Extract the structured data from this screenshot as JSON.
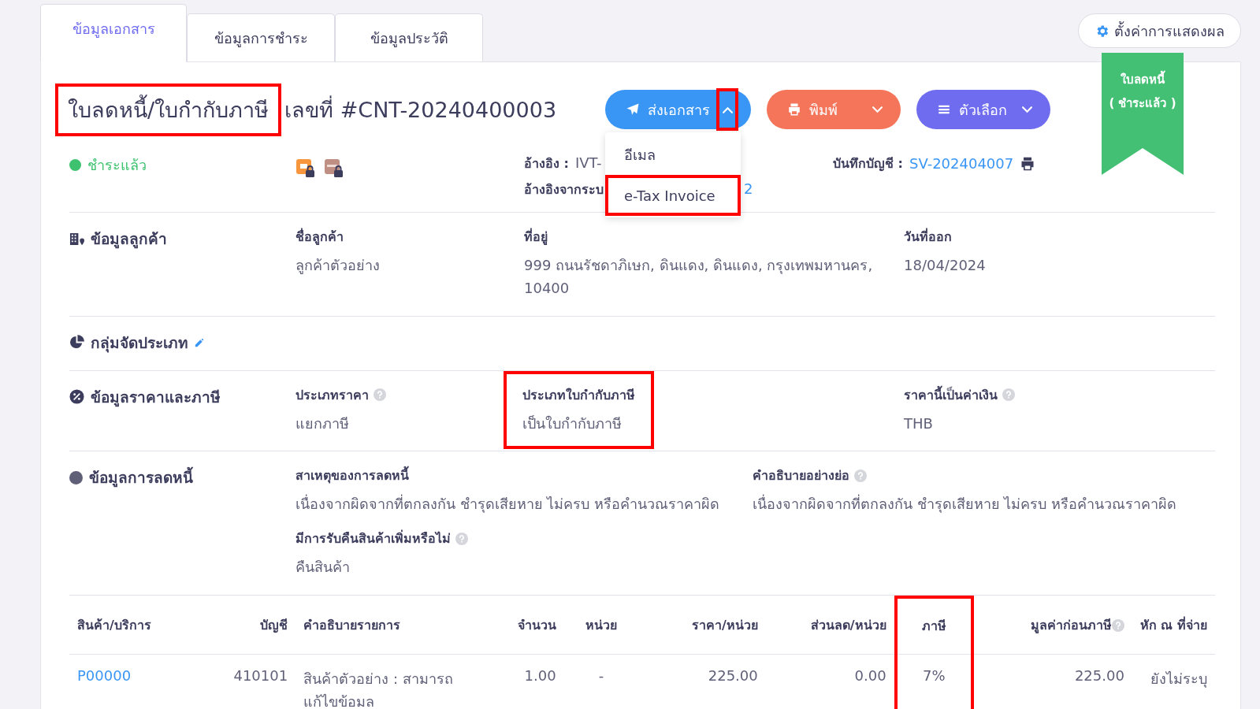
{
  "tabs": [
    {
      "label": "ข้อมูลเอกสาร",
      "selected": true
    },
    {
      "label": "ข้อมูลการชำระ",
      "selected": false
    },
    {
      "label": "ข้อมูลประวัติ",
      "selected": false
    }
  ],
  "settings_button": {
    "label": "ตั้งค่าการแสดงผล"
  },
  "ribbon": {
    "title": "ใบลดหนี้",
    "status": "( ชำระแล้ว )"
  },
  "document": {
    "doc_type": "ใบลดหนี้/ใบกำกับภาษี",
    "doc_type_highlighted": true,
    "number": "เลขที่ #CNT-20240400003"
  },
  "actions": [
    {
      "kind": "send",
      "label": "ส่งเอกสาร",
      "open": true,
      "highlighted": true
    },
    {
      "kind": "print",
      "label": "พิมพ์",
      "open": false,
      "highlighted": false
    },
    {
      "kind": "options",
      "label": "ตัวเลือก",
      "open": false,
      "highlighted": false
    }
  ],
  "send_menu": [
    {
      "label": "อีเมล",
      "highlighted": false
    },
    {
      "label": "e-Tax Invoice",
      "highlighted": true
    }
  ],
  "status": {
    "label": "ชำระแล้ว",
    "color": "#3ec26f"
  },
  "references": [
    {
      "label": "อ้างอิง :",
      "value": "IVT-"
    },
    {
      "label": "อ้างอิงจากระบ",
      "value": "2"
    }
  ],
  "accounting": {
    "label": "บันทึกบัญชี :",
    "value": "SV-202404007"
  },
  "customer": {
    "title": "ข้อมูลลูกค้า",
    "fields": [
      {
        "label": "ชื่อลูกค้า",
        "value": "ลูกค้าตัวอย่าง"
      },
      {
        "label": "ที่อยู่",
        "value": "999 ถนนรัชดาภิเษก, ดินแดง, ดินแดง, กรุงเทพมหานคร, 10400"
      },
      {
        "label": "วันที่ออก",
        "value": "18/04/2024"
      }
    ]
  },
  "category": {
    "title": "กลุ่มจัดประเภท"
  },
  "pricing": {
    "title": "ข้อมูลราคาและภาษี",
    "fields": [
      {
        "label": "ประเภทราคา",
        "value": "แยกภาษี",
        "help": true,
        "highlighted": false
      },
      {
        "label": "ประเภทใบกำกับภาษี",
        "value": "เป็นใบกำกับภาษี",
        "help": false,
        "highlighted": true
      },
      {
        "label": "ราคานี้เป็นค่าเงิน",
        "value": "THB",
        "help": true,
        "highlighted": false
      }
    ]
  },
  "debit": {
    "title": "ข้อมูลการลดหนี้",
    "fields": [
      {
        "label": "สาเหตุของการลดหนี้",
        "value": "เนื่องจากผิดจากที่ตกลงกัน ชำรุดเสียหาย ไม่ครบ หรือคำนวณราคาผิด",
        "help": false
      },
      {
        "label": "คำอธิบายอย่างย่อ",
        "value": "เนื่องจากผิดจากที่ตกลงกัน ชำรุดเสียหาย ไม่ครบ หรือคำนวณราคาผิด",
        "help": true
      },
      {
        "label": "มีการรับคืนสินค้าเพิ่มหรือไม่",
        "value": "คืนสินค้า",
        "help": true
      }
    ]
  },
  "table": {
    "columns": [
      {
        "label": "สินค้า/บริการ",
        "help": false,
        "highlighted": false
      },
      {
        "label": "บัญชี",
        "help": false,
        "highlighted": false
      },
      {
        "label": "คำอธิบายรายการ",
        "help": false,
        "highlighted": false
      },
      {
        "label": "จำนวน",
        "help": false,
        "highlighted": false
      },
      {
        "label": "หน่วย",
        "help": false,
        "highlighted": false
      },
      {
        "label": "ราคา/หน่วย",
        "help": false,
        "highlighted": false
      },
      {
        "label": "ส่วนลด/หน่วย",
        "help": false,
        "highlighted": false
      },
      {
        "label": "ภาษี",
        "help": false,
        "highlighted": true
      },
      {
        "label": "มูลค่าก่อนภาษี",
        "help": true,
        "highlighted": false
      },
      {
        "label": "หัก ณ ที่จ่าย",
        "help": false,
        "highlighted": false
      }
    ],
    "rows": [
      [
        "P00000",
        "410101",
        "สินค้าตัวอย่าง : สามารถแก้ไขข้อมล",
        "1.00",
        "-",
        "225.00",
        "0.00",
        "7%",
        "225.00",
        "ยังไม่ระบุ"
      ]
    ]
  }
}
